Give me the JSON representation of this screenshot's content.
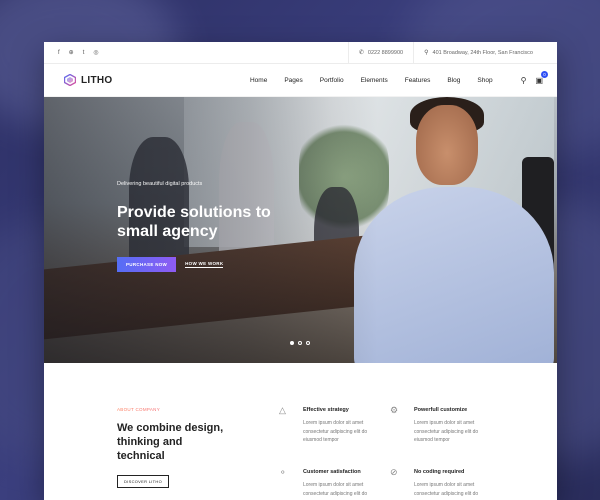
{
  "topbar": {
    "social": [
      "f",
      "⊕",
      "t",
      "◎"
    ],
    "phone_icon": "phone-icon",
    "phone": "0222 8899900",
    "address_icon": "map-pin-icon",
    "address": "401 Broadway, 24th Floor, San Francisco"
  },
  "nav": {
    "logo": "LITHO",
    "menu": [
      "Home",
      "Pages",
      "Portfolio",
      "Elements",
      "Features",
      "Blog",
      "Shop"
    ],
    "cart_count": "0"
  },
  "hero": {
    "kicker": "Delivering beautiful digital products",
    "title": "Provide solutions to small agency",
    "primary_button": "PURCHASE NOW",
    "secondary_button": "HOW WE WORK"
  },
  "about": {
    "tag": "ABOUT COMPANY",
    "title": "We combine design, thinking and technical",
    "button": "DISCOVER LITHO"
  },
  "features": [
    {
      "icon": "strategy-icon",
      "title": "Effective strategy",
      "text": "Lorem ipsum dolor sit amet consectetur adipiscing elit do eiusmod tempor"
    },
    {
      "icon": "gear-icon",
      "title": "Powerfull customize",
      "text": "Lorem ipsum dolor sit amet consectetur adipiscing elit do eiusmod tempor"
    },
    {
      "icon": "award-icon",
      "title": "Customer satisfaction",
      "text": "Lorem ipsum dolor sit amet consectetur adipiscing elit do"
    },
    {
      "icon": "no-coding-icon",
      "title": "No coding required",
      "text": "Lorem ipsum dolor sit amet consectetur adipiscing elit do"
    }
  ],
  "colors": {
    "accent": "#556ef5",
    "accent2": "#8e5bf3",
    "badge": "#2e4ff5"
  }
}
